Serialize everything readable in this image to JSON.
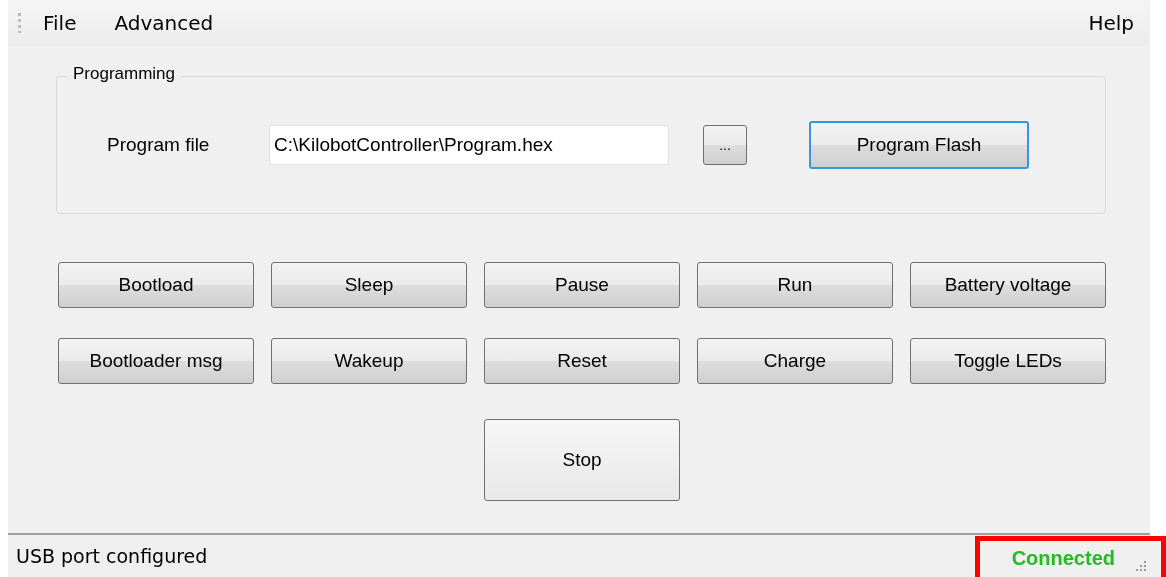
{
  "menu": {
    "items": [
      "File",
      "Advanced"
    ],
    "help": "Help"
  },
  "programming": {
    "title": "Programming",
    "label": "Program file",
    "value": "C:\\KilobotController\\Program.hex",
    "browse": "...",
    "flash": {
      "label": "Program Flash",
      "focused": true
    }
  },
  "buttons": [
    [
      "Bootload",
      "Sleep",
      "Pause",
      "Run",
      "Battery voltage"
    ],
    [
      "Bootloader msg",
      "Wakeup",
      "Reset",
      "Charge",
      "Toggle LEDs"
    ]
  ],
  "stop": "Stop",
  "status_bar": {
    "message": "USB port configured",
    "connection": {
      "text": "Connected",
      "color": "#22bb22"
    }
  }
}
